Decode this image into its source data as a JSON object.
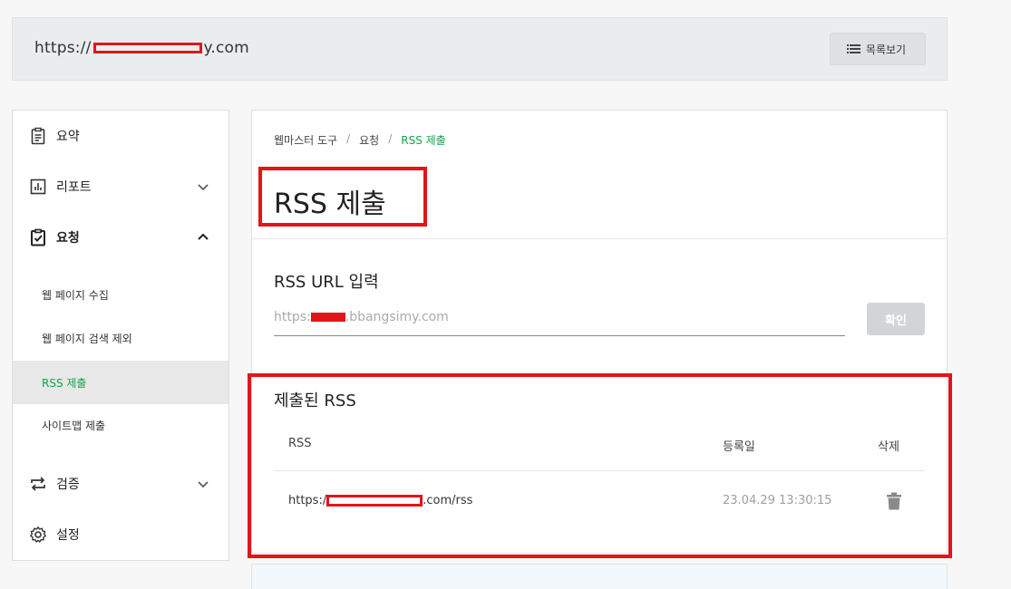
{
  "header": {
    "site_url_prefix": "https://",
    "site_url_suffix": "y.com",
    "list_button_label": "목록보기"
  },
  "sidebar": {
    "items": [
      {
        "label": "요약",
        "icon": "clipboard-icon"
      },
      {
        "label": "리포트",
        "icon": "chart-icon"
      },
      {
        "label": "요청",
        "icon": "clipboard-check-icon"
      },
      {
        "label": "검증",
        "icon": "repeat-icon"
      },
      {
        "label": "설정",
        "icon": "gear-icon"
      }
    ],
    "sub_items": [
      {
        "label": "웹 페이지 수집"
      },
      {
        "label": "웹 페이지 검색 제외"
      },
      {
        "label": "RSS 제출",
        "active": true
      },
      {
        "label": "사이트맵 제출"
      }
    ]
  },
  "breadcrumb": {
    "items": [
      "웹마스터 도구",
      "요청",
      "RSS 제출"
    ],
    "separator": "/"
  },
  "page": {
    "title": "RSS 제출"
  },
  "rss_input": {
    "label": "RSS URL 입력",
    "placeholder_prefix": "https:",
    "placeholder_suffix": ".bbangsimy.com",
    "button_label": "확인"
  },
  "submitted": {
    "title": "제출된 RSS",
    "columns": [
      "RSS",
      "등록일",
      "삭제"
    ],
    "rows": [
      {
        "rss_prefix": "https:/",
        "rss_suffix": ".com/rss",
        "date": "23.04.29 13:30:15"
      }
    ]
  },
  "colors": {
    "accent_green": "#16a34a",
    "annotation_red": "#e3141b"
  }
}
